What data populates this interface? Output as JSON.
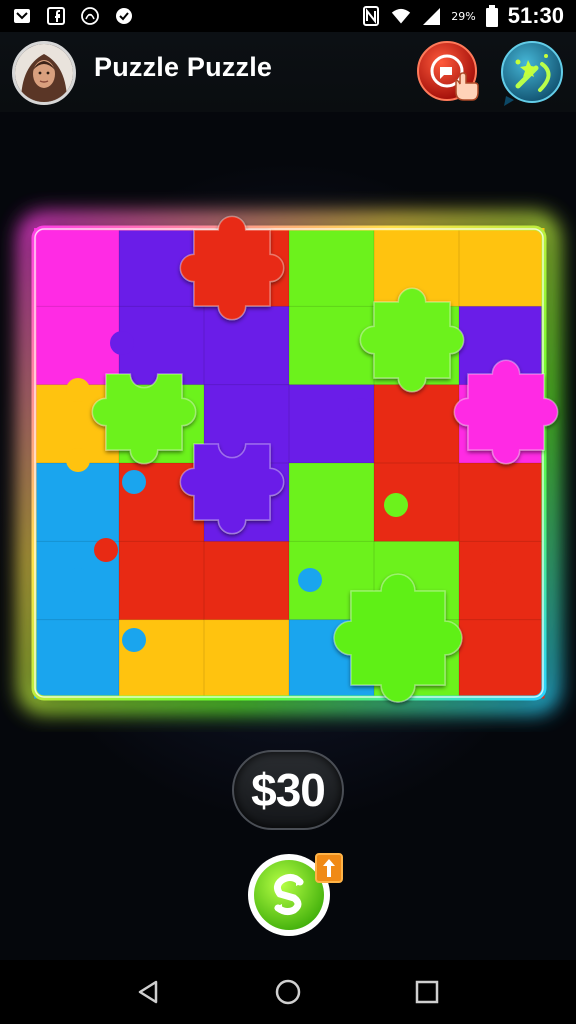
{
  "status_bar": {
    "time": "51:30",
    "battery": "29%",
    "icons": [
      "notification-icon",
      "facebook-icon",
      "spiral-icon",
      "check-circle-icon",
      "nfc-icon",
      "wifi-icon",
      "signal-icon",
      "battery-icon"
    ]
  },
  "header": {
    "title": "Puzzle Puzzle",
    "avatar_icon": "avatar",
    "hint_icon": "hint-hand-icon",
    "magic_icon": "magic-wand-icon"
  },
  "board": {
    "rows": 6,
    "cols": 6,
    "tiles": [
      [
        "#ff2be4",
        "#6a1de8",
        "#e82a14",
        "#6cf21c",
        "#ffc30f",
        "#ffc30f"
      ],
      [
        "#ff2be4",
        "#6a1de8",
        "#6a1de8",
        "#6cf21c",
        "#6cf21c",
        "#6a1de8"
      ],
      [
        "#ffc30f",
        "#6cf21c",
        "#6a1de8",
        "#6a1de8",
        "#e82a14",
        "#ff2be4"
      ],
      [
        "#1aa5ee",
        "#e82a14",
        "#6a1de8",
        "#6cf21c",
        "#e82a14",
        "#e82a14"
      ],
      [
        "#1aa5ee",
        "#e82a14",
        "#e82a14",
        "#6cf21c",
        "#6cf21c",
        "#e82a14"
      ],
      [
        "#1aa5ee",
        "#ffc30f",
        "#ffc30f",
        "#1aa5ee",
        "#6cf21c",
        "#e82a14"
      ]
    ],
    "floating_pieces": [
      {
        "name": "red",
        "color": "#e82a14"
      },
      {
        "name": "green",
        "color": "#6cf21c"
      },
      {
        "name": "magenta",
        "color": "#ff2be4"
      },
      {
        "name": "purple",
        "color": "#6a1de8"
      },
      {
        "name": "bright-green",
        "color": "#5ef016"
      }
    ],
    "glow_colors": [
      "#ff3de6",
      "#ffe14a",
      "#62ff2a",
      "#2bd3ff"
    ]
  },
  "price": "$30",
  "coin_icon": "refresh-coin-icon",
  "upgrade_icon": "arrow-up-icon",
  "nav": {
    "icons": [
      "back-icon",
      "home-icon",
      "recents-icon"
    ]
  },
  "colors": {
    "accent_green": "#7cf51c",
    "hint_red": "#e01a10",
    "magic_teal": "#1d7fa0"
  }
}
